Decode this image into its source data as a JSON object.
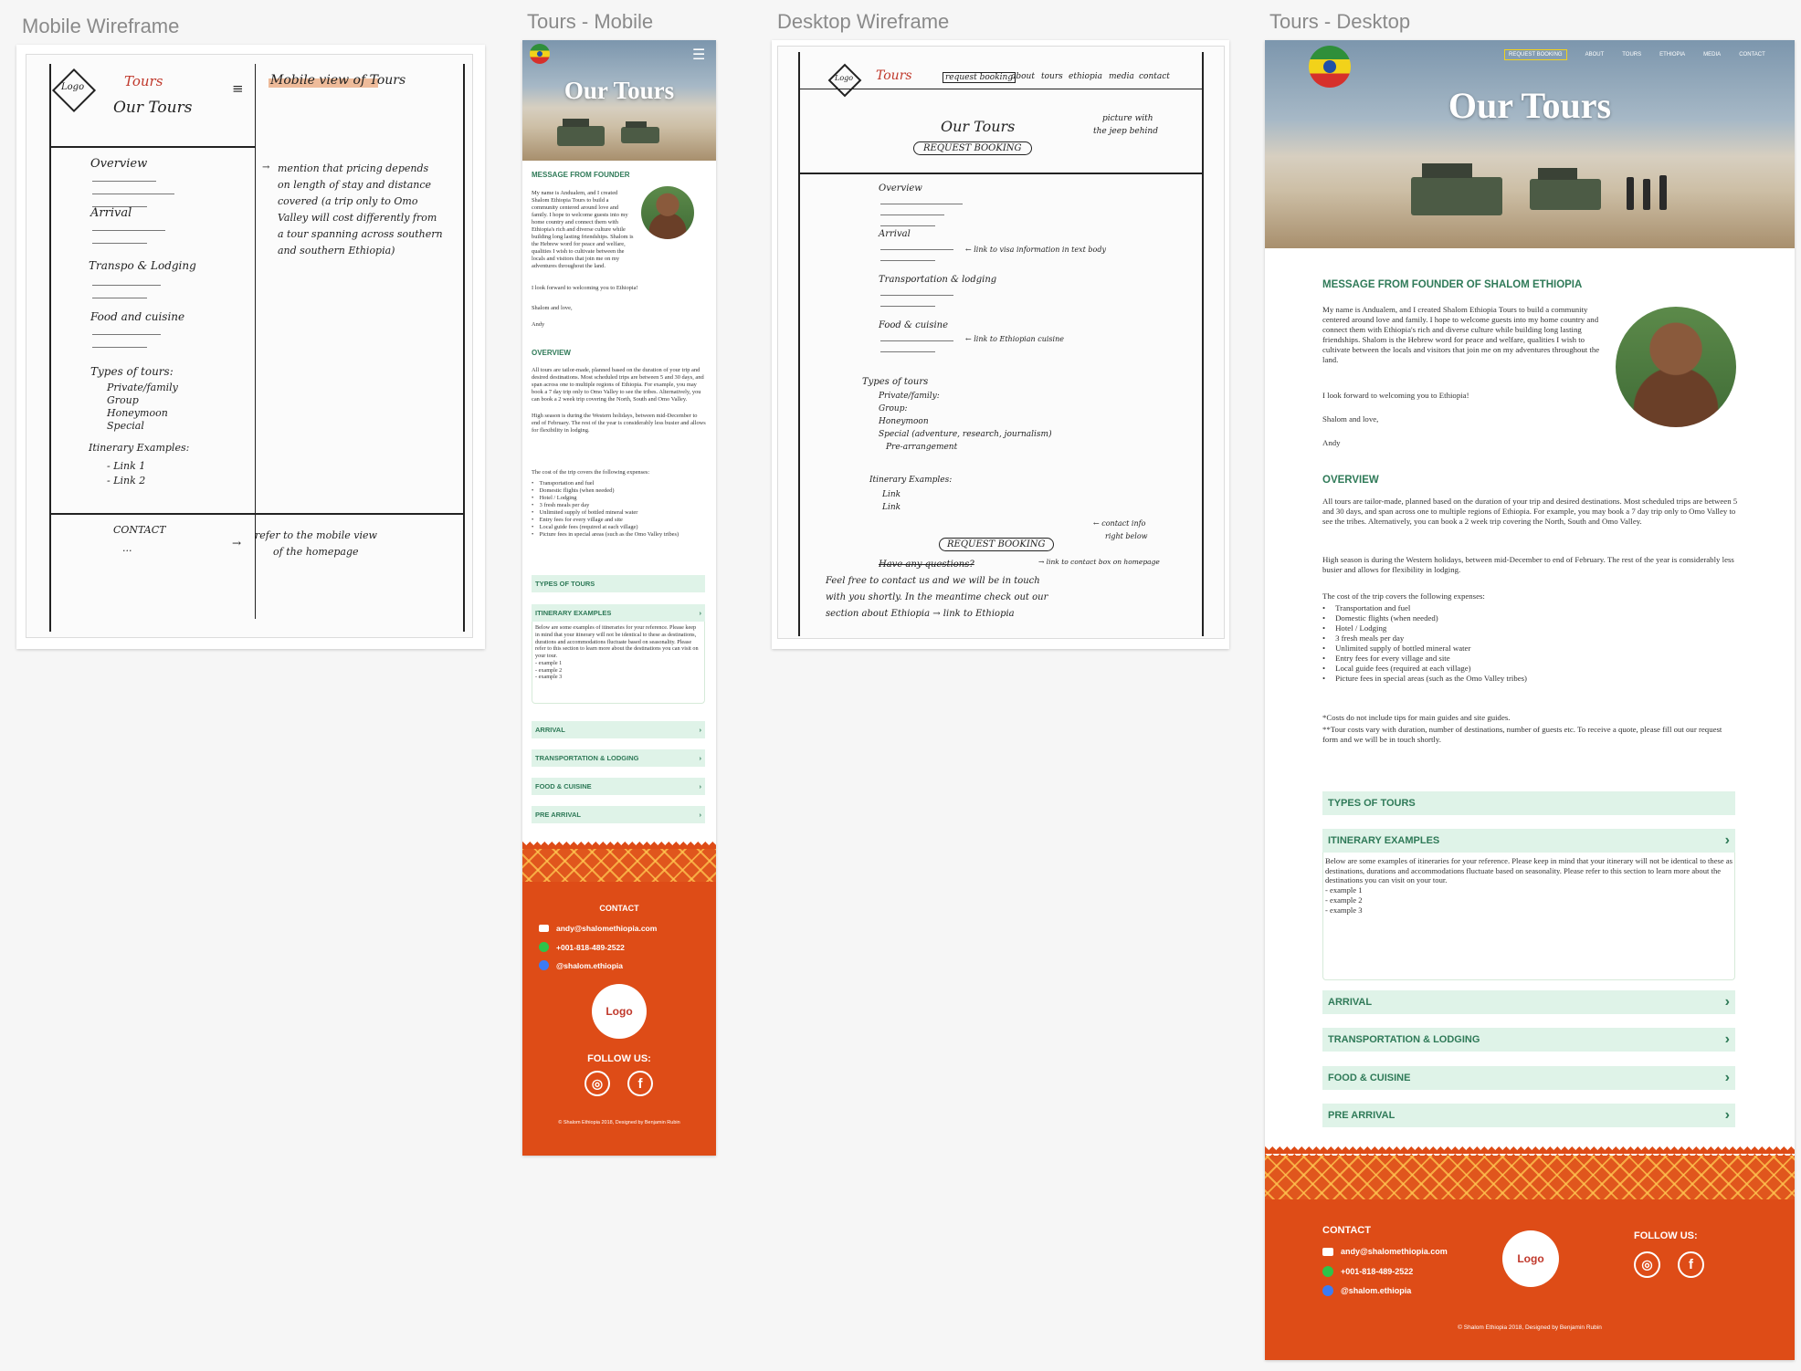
{
  "frames": {
    "mobile_wireframe": "Mobile Wireframe",
    "tours_mobile": "Tours - Mobile",
    "desktop_wireframe": "Desktop Wireframe",
    "tours_desktop": "Tours - Desktop"
  },
  "mobile_wireframe": {
    "logo": "Logo",
    "brand": "Tours",
    "heading": "Our Tours",
    "right_heading": "Mobile view of Tours",
    "items": [
      "Overview",
      "Arrival",
      "Transpo & Lodging",
      "Food and cuisine",
      "Types of tours:",
      "Private/family",
      "Group",
      "Honeymoon",
      "Special",
      "Itinerary Examples:",
      "- Link 1",
      "- Link 2"
    ],
    "notes": [
      "mention that pricing depends",
      "on length of stay and distance",
      "covered (a trip only to Omo",
      "Valley will cost differently from",
      "a tour spanning across southern",
      "and southern Ethiopia)"
    ],
    "contact": "CONTACT",
    "contact_dots": "...",
    "footer_note": [
      "refer to the mobile view",
      "of the homepage"
    ]
  },
  "desktop_wireframe": {
    "logo": "Logo",
    "brand": "Tours",
    "nav": [
      "request booking",
      "about",
      "tours",
      "ethiopia",
      "media",
      "contact"
    ],
    "heading": "Our Tours",
    "hero_note": [
      "picture with",
      "the jeep behind"
    ],
    "request_button": "REQUEST BOOKING",
    "items": [
      "Overview",
      "Arrival",
      "Transportation & lodging",
      "Food & cuisine",
      "Types of tours",
      "Private/family:",
      "Group:",
      "Honeymoon",
      "Special (adventure, research, journalism)",
      "Pre-arrangement",
      "Itinerary Examples:",
      "Link",
      "Link"
    ],
    "notes": [
      "← link to visa information in text body",
      "← link to Ethiopian cuisine"
    ],
    "request_button_2": "REQUEST BOOKING",
    "contact_note": [
      "← contact info",
      "right below"
    ],
    "questions": "Have any questions?",
    "questions_note": "→ link to contact box on homepage",
    "feel_free": [
      "Feel free to contact us and we will be in touch",
      "with you shortly. In the meantime check out our",
      "section about Ethiopia → link to Ethiopia"
    ]
  },
  "site": {
    "hero_title": "Our Tours",
    "nav": [
      "REQUEST BOOKING",
      "ABOUT",
      "TOURS",
      "ETHIOPIA",
      "MEDIA",
      "CONTACT"
    ],
    "message_heading_mobile": "MESSAGE FROM FOUNDER",
    "message_heading_desktop": "MESSAGE FROM FOUNDER OF SHALOM ETHIOPIA",
    "message_body": "My name is Andualem, and I created Shalom Ethiopia Tours to build a community centered around love and family. I hope to welcome guests into my home country and connect them with Ethiopia's rich and diverse culture while building long lasting friendships. Shalom is the Hebrew word for peace and welfare, qualities I wish to cultivate between the locals and visitors that join me on my adventures throughout the land.",
    "message_welcome": "I look forward to welcoming you to Ethiopia!",
    "message_signoff": "Shalom and love,",
    "message_name": "Andy",
    "overview_heading": "OVERVIEW",
    "overview_p1": "All tours are tailor-made, planned based on the duration of your trip and desired destinations. Most scheduled trips are between 5 and 30 days, and span across one to multiple regions of Ethiopia. For example, you may book a 7 day trip only to Omo Valley to see the tribes. Alternatively, you can book a 2 week trip covering the North, South and Omo Valley.",
    "overview_p2": "High season is during the Western holidays, between mid-December to end of February. The rest of the year is considerably less busier and allows for flexibility in lodging.",
    "overview_p3": "The cost of the trip covers the following expenses:",
    "expenses": [
      "Transportation and fuel",
      "Domestic flights (when needed)",
      "Hotel / Lodging",
      "3 fresh meals per day",
      "Unlimited supply of bottled mineral water",
      "Entry fees for every village and site",
      "Local guide fees (required at each village)",
      "Picture fees in special areas (such as the Omo Valley tribes)"
    ],
    "note1": "*Costs do not include tips for main guides and site guides.",
    "note2": "**Tour costs vary with duration, number of destinations, number of guests etc. To receive a quote, please fill out our request form and we will be in touch shortly.",
    "types_of_tours": "TYPES OF TOURS",
    "itinerary_examples": "ITINERARY EXAMPLES",
    "itinerary_body": "Below are some examples of itineraries for your reference. Please keep in mind that your itinerary will not be identical to these as destinations, durations and accommodations fluctuate based on seasonality. Please refer to this section to learn more about the destinations you can visit on your tour.",
    "examples": [
      "- example 1",
      "- example 2",
      "- example 3"
    ],
    "accordions": [
      "ARRIVAL",
      "TRANSPORTATION & LODGING",
      "FOOD & CUISINE",
      "PRE ARRIVAL"
    ],
    "chevron": "›",
    "contact_heading": "CONTACT",
    "email": "andy@shalomethiopia.com",
    "phone": "+001-818-489-2522",
    "handle": "@shalom.ethiopia",
    "logo": "Logo",
    "follow": "FOLLOW US:",
    "instagram_glyph": "◎",
    "facebook_glyph": "f",
    "copyright": "© Shalom Ethiopia 2018, Designed by Benjamin Rubin",
    "colors": {
      "green": "#2f7a58",
      "mint": "#dff3e8",
      "orange": "#de4c17",
      "logo_text": "#c0382b"
    }
  }
}
